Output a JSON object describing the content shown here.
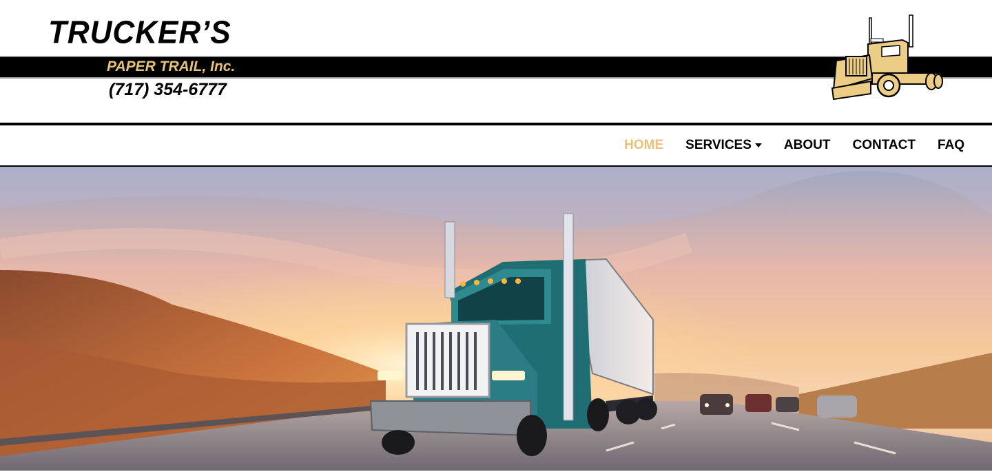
{
  "brand": {
    "title": "TRUCKER’S",
    "subtitle": "PAPER TRAIL, Inc.",
    "phone": "(717) 354-6777"
  },
  "nav": {
    "items": [
      {
        "label": "HOME",
        "active": true
      },
      {
        "label": "SERVICES",
        "dropdown": true
      },
      {
        "label": "ABOUT"
      },
      {
        "label": "CONTACT"
      },
      {
        "label": "FAQ"
      }
    ]
  },
  "colors": {
    "accent_gold": "#e8c27a",
    "text": "#000000",
    "truck_cab": "#1f6e73"
  },
  "icons": {
    "logo": "semi-truck-logo",
    "services_dropdown": "caret-down-icon"
  }
}
